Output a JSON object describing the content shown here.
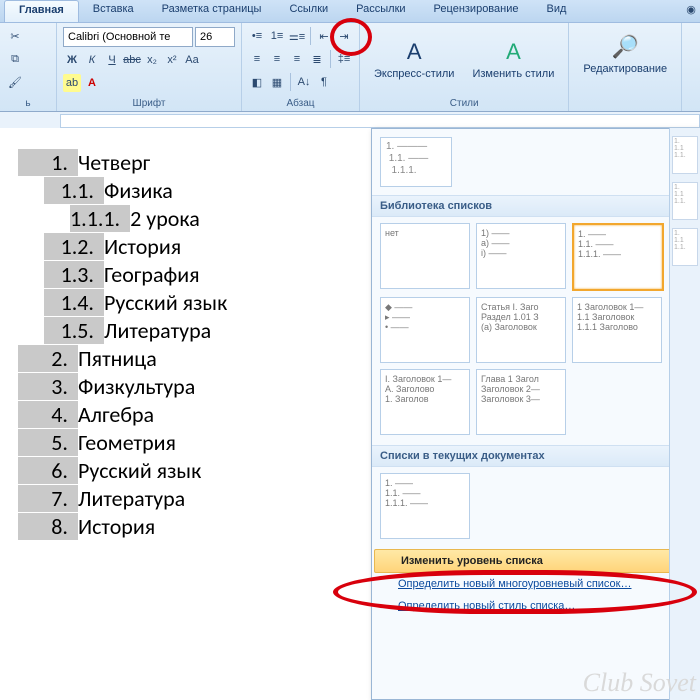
{
  "tabs": {
    "items": [
      "Главная",
      "Вставка",
      "Разметка страницы",
      "Ссылки",
      "Рассылки",
      "Рецензирование",
      "Вид"
    ],
    "active_index": 0
  },
  "ribbon": {
    "font_group_label": "Шрифт",
    "para_group_label": "Абзац",
    "styles_group_label": "Стили",
    "edit_group_label": "Редактирование",
    "font_name": "Calibri (Основной те",
    "font_size": "26",
    "express_styles_label": "Экспресс-стили",
    "change_styles_label": "Изменить стили"
  },
  "document": {
    "lines": [
      {
        "level": 1,
        "num": "1.",
        "text": "Четверг",
        "hl": true
      },
      {
        "level": 2,
        "num": "1.1.",
        "text": "Физика",
        "hl": true
      },
      {
        "level": 3,
        "num": "1.1.1.",
        "text": "2 урока",
        "hl": true
      },
      {
        "level": 2,
        "num": "1.2.",
        "text": "История",
        "hl": true
      },
      {
        "level": 2,
        "num": "1.3.",
        "text": "География",
        "hl": true
      },
      {
        "level": 2,
        "num": "1.4.",
        "text": "Русский язык",
        "hl": true
      },
      {
        "level": 2,
        "num": "1.5.",
        "text": "Литература",
        "hl": true
      },
      {
        "level": 1,
        "num": "2.",
        "text": "Пятница",
        "hl": true
      },
      {
        "level": 1,
        "num": "3.",
        "text": "Физкультура",
        "hl": true
      },
      {
        "level": 1,
        "num": "4.",
        "text": "Алгебра",
        "hl": true
      },
      {
        "level": 1,
        "num": "5.",
        "text": "Геометрия",
        "hl": true
      },
      {
        "level": 1,
        "num": "6.",
        "text": "Русский язык",
        "hl": true
      },
      {
        "level": 1,
        "num": "7.",
        "text": "Литература",
        "hl": true
      },
      {
        "level": 1,
        "num": "8.",
        "text": "История",
        "hl": true
      }
    ]
  },
  "panel": {
    "current_preview": "1. ——\n 1.1. ——\n  1.1.1. —",
    "section_library": "Библиотека списков",
    "section_current_docs": "Списки в текущих документах",
    "tiles_row1": [
      {
        "t": "нет",
        "sel": false
      },
      {
        "t": "1) ——\na) ——\n i) ——",
        "sel": false
      },
      {
        "t": "1. ——\n1.1. ——\n1.1.1. ——",
        "sel": true
      }
    ],
    "tiles_row2": [
      {
        "t": "◆ ——\n▸ ——\n• ——",
        "sel": false
      },
      {
        "t": "Статья I. Заго\nРаздел 1.01 З\n(a) Заголовок",
        "sel": false
      },
      {
        "t": "1 Заголовок 1—\n1.1 Заголовок\n1.1.1 Заголово",
        "sel": false
      }
    ],
    "tiles_row3": [
      {
        "t": "I. Заголовок 1—\nA. Заголово\n1. Заголов",
        "sel": false
      },
      {
        "t": "Глава 1 Загол\nЗаголовок 2—\nЗаголовок 3—",
        "sel": false
      }
    ],
    "tiles_docs": [
      {
        "t": "1. ——\n1.1. ——\n1.1.1. ——",
        "sel": false
      }
    ],
    "menu": {
      "change_level": "Изменить уровень списка",
      "define_list": "Определить новый многоуровневый список…",
      "define_style": "Определить новый стиль списка…"
    }
  },
  "watermark": "Club Sovet"
}
